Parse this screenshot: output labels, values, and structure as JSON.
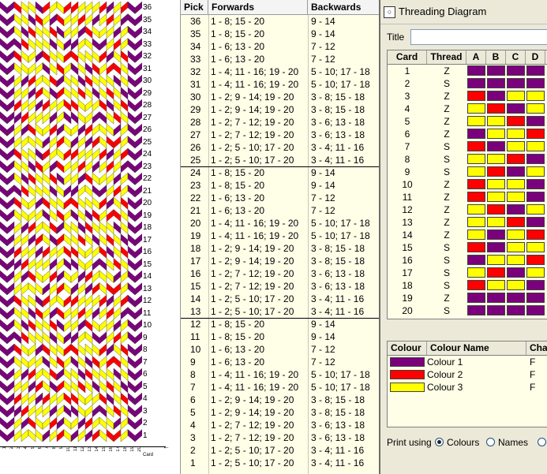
{
  "colors": {
    "purple": "#7b007b",
    "red": "#ff0000",
    "yellow": "#ffff00"
  },
  "weave": {
    "row_numbers": [
      "36",
      "35",
      "34",
      "33",
      "32",
      "31",
      "30",
      "29",
      "28",
      "27",
      "26",
      "25",
      "24",
      "23",
      "22",
      "21",
      "20",
      "19",
      "18",
      "17",
      "16",
      "15",
      "14",
      "13",
      "12",
      "11",
      "10",
      "9",
      "8",
      "7",
      "6",
      "5",
      "4",
      "3",
      "2",
      "1"
    ],
    "card_numbers": [
      "1",
      "2",
      "3",
      "4",
      "5",
      "6",
      "7",
      "8",
      "9",
      "10",
      "11",
      "12",
      "13",
      "14",
      "15",
      "16",
      "17",
      "18",
      "19",
      "20"
    ],
    "card_axis_label": "Card"
  },
  "pick_table": {
    "headers": {
      "pick": "Pick",
      "forwards": "Forwards",
      "backwards": "Backwards"
    },
    "rows": [
      {
        "pick": "36",
        "fwd": "1 - 8; 15 - 20",
        "bwd": "9 - 14"
      },
      {
        "pick": "35",
        "fwd": "1 - 8; 15 - 20",
        "bwd": "9 - 14"
      },
      {
        "pick": "34",
        "fwd": "1 - 6; 13 - 20",
        "bwd": "7 - 12"
      },
      {
        "pick": "33",
        "fwd": "1 - 6; 13 - 20",
        "bwd": "7 - 12"
      },
      {
        "pick": "32",
        "fwd": "1 - 4; 11 - 16; 19 - 20",
        "bwd": "5 - 10; 17 - 18"
      },
      {
        "pick": "31",
        "fwd": "1 - 4; 11 - 16; 19 - 20",
        "bwd": "5 - 10; 17 - 18"
      },
      {
        "pick": "30",
        "fwd": "1 - 2; 9 - 14; 19 - 20",
        "bwd": "3 - 8; 15 - 18"
      },
      {
        "pick": "29",
        "fwd": "1 - 2; 9 - 14; 19 - 20",
        "bwd": "3 - 8; 15 - 18"
      },
      {
        "pick": "28",
        "fwd": "1 - 2; 7 - 12; 19 - 20",
        "bwd": "3 - 6; 13 - 18"
      },
      {
        "pick": "27",
        "fwd": "1 - 2; 7 - 12; 19 - 20",
        "bwd": "3 - 6; 13 - 18"
      },
      {
        "pick": "26",
        "fwd": "1 - 2; 5 - 10; 17 - 20",
        "bwd": "3 - 4; 11 - 16"
      },
      {
        "pick": "25",
        "fwd": "1 - 2; 5 - 10; 17 - 20",
        "bwd": "3 - 4; 11 - 16"
      },
      {
        "pick": "24",
        "fwd": "1 - 8; 15 - 20",
        "bwd": "9 - 14"
      },
      {
        "pick": "23",
        "fwd": "1 - 8; 15 - 20",
        "bwd": "9 - 14"
      },
      {
        "pick": "22",
        "fwd": "1 - 6; 13 - 20",
        "bwd": "7 - 12"
      },
      {
        "pick": "21",
        "fwd": "1 - 6; 13 - 20",
        "bwd": "7 - 12"
      },
      {
        "pick": "20",
        "fwd": "1 - 4; 11 - 16; 19 - 20",
        "bwd": "5 - 10; 17 - 18"
      },
      {
        "pick": "19",
        "fwd": "1 - 4; 11 - 16; 19 - 20",
        "bwd": "5 - 10; 17 - 18"
      },
      {
        "pick": "18",
        "fwd": "1 - 2; 9 - 14; 19 - 20",
        "bwd": "3 - 8; 15 - 18"
      },
      {
        "pick": "17",
        "fwd": "1 - 2; 9 - 14; 19 - 20",
        "bwd": "3 - 8; 15 - 18"
      },
      {
        "pick": "16",
        "fwd": "1 - 2; 7 - 12; 19 - 20",
        "bwd": "3 - 6; 13 - 18"
      },
      {
        "pick": "15",
        "fwd": "1 - 2; 7 - 12; 19 - 20",
        "bwd": "3 - 6; 13 - 18"
      },
      {
        "pick": "14",
        "fwd": "1 - 2; 5 - 10; 17 - 20",
        "bwd": "3 - 4; 11 - 16"
      },
      {
        "pick": "13",
        "fwd": "1 - 2; 5 - 10; 17 - 20",
        "bwd": "3 - 4; 11 - 16"
      },
      {
        "pick": "12",
        "fwd": "1 - 8; 15 - 20",
        "bwd": "9 - 14"
      },
      {
        "pick": "11",
        "fwd": "1 - 8; 15 - 20",
        "bwd": "9 - 14"
      },
      {
        "pick": "10",
        "fwd": "1 - 6; 13 - 20",
        "bwd": "7 - 12"
      },
      {
        "pick": "9",
        "fwd": "1 - 6; 13 - 20",
        "bwd": "7 - 12"
      },
      {
        "pick": "8",
        "fwd": "1 - 4; 11 - 16; 19 - 20",
        "bwd": "5 - 10; 17 - 18"
      },
      {
        "pick": "7",
        "fwd": "1 - 4; 11 - 16; 19 - 20",
        "bwd": "5 - 10; 17 - 18"
      },
      {
        "pick": "6",
        "fwd": "1 - 2; 9 - 14; 19 - 20",
        "bwd": "3 - 8; 15 - 18"
      },
      {
        "pick": "5",
        "fwd": "1 - 2; 9 - 14; 19 - 20",
        "bwd": "3 - 8; 15 - 18"
      },
      {
        "pick": "4",
        "fwd": "1 - 2; 7 - 12; 19 - 20",
        "bwd": "3 - 6; 13 - 18"
      },
      {
        "pick": "3",
        "fwd": "1 - 2; 7 - 12; 19 - 20",
        "bwd": "3 - 6; 13 - 18"
      },
      {
        "pick": "2",
        "fwd": "1 - 2; 5 - 10; 17 - 20",
        "bwd": "3 - 4; 11 - 16"
      },
      {
        "pick": "1",
        "fwd": "1 - 2; 5 - 10; 17 - 20",
        "bwd": "3 - 4; 11 - 16"
      }
    ]
  },
  "threading": {
    "window_title": "Threading Diagram",
    "title_label": "Title",
    "title_value": "",
    "headers": {
      "card": "Card",
      "thread": "Thread",
      "holes": [
        "A",
        "B",
        "C",
        "D"
      ]
    },
    "cards": [
      {
        "card": "1",
        "thread": "Z",
        "holes": [
          "purple",
          "purple",
          "purple",
          "purple"
        ]
      },
      {
        "card": "2",
        "thread": "S",
        "holes": [
          "purple",
          "purple",
          "purple",
          "purple"
        ]
      },
      {
        "card": "3",
        "thread": "Z",
        "holes": [
          "red",
          "purple",
          "yellow",
          "yellow"
        ]
      },
      {
        "card": "4",
        "thread": "Z",
        "holes": [
          "yellow",
          "red",
          "purple",
          "yellow"
        ]
      },
      {
        "card": "5",
        "thread": "Z",
        "holes": [
          "yellow",
          "yellow",
          "red",
          "purple"
        ]
      },
      {
        "card": "6",
        "thread": "Z",
        "holes": [
          "purple",
          "yellow",
          "yellow",
          "red"
        ]
      },
      {
        "card": "7",
        "thread": "S",
        "holes": [
          "red",
          "purple",
          "yellow",
          "yellow"
        ]
      },
      {
        "card": "8",
        "thread": "S",
        "holes": [
          "yellow",
          "yellow",
          "red",
          "purple"
        ]
      },
      {
        "card": "9",
        "thread": "S",
        "holes": [
          "yellow",
          "red",
          "purple",
          "yellow"
        ]
      },
      {
        "card": "10",
        "thread": "Z",
        "holes": [
          "red",
          "yellow",
          "yellow",
          "purple"
        ]
      },
      {
        "card": "11",
        "thread": "Z",
        "holes": [
          "red",
          "yellow",
          "yellow",
          "purple"
        ]
      },
      {
        "card": "12",
        "thread": "Z",
        "holes": [
          "yellow",
          "red",
          "purple",
          "yellow"
        ]
      },
      {
        "card": "13",
        "thread": "Z",
        "holes": [
          "yellow",
          "yellow",
          "red",
          "purple"
        ]
      },
      {
        "card": "14",
        "thread": "Z",
        "holes": [
          "yellow",
          "purple",
          "yellow",
          "red"
        ]
      },
      {
        "card": "15",
        "thread": "S",
        "holes": [
          "red",
          "purple",
          "yellow",
          "yellow"
        ]
      },
      {
        "card": "16",
        "thread": "S",
        "holes": [
          "purple",
          "yellow",
          "yellow",
          "red"
        ]
      },
      {
        "card": "17",
        "thread": "S",
        "holes": [
          "yellow",
          "red",
          "purple",
          "yellow"
        ]
      },
      {
        "card": "18",
        "thread": "S",
        "holes": [
          "red",
          "yellow",
          "yellow",
          "purple"
        ]
      },
      {
        "card": "19",
        "thread": "Z",
        "holes": [
          "purple",
          "purple",
          "purple",
          "purple"
        ]
      },
      {
        "card": "20",
        "thread": "S",
        "holes": [
          "purple",
          "purple",
          "purple",
          "purple"
        ]
      }
    ],
    "colour_headers": {
      "colour": "Colour",
      "name": "Colour Name",
      "character": "Character"
    },
    "colours": [
      {
        "swatch": "purple",
        "name": "Colour 1",
        "char": "F"
      },
      {
        "swatch": "red",
        "name": "Colour 2",
        "char": "F"
      },
      {
        "swatch": "yellow",
        "name": "Colour 3",
        "char": "F"
      }
    ],
    "print": {
      "label": "Print using",
      "options": [
        "Colours",
        "Names",
        ""
      ],
      "selected": "Colours"
    }
  }
}
